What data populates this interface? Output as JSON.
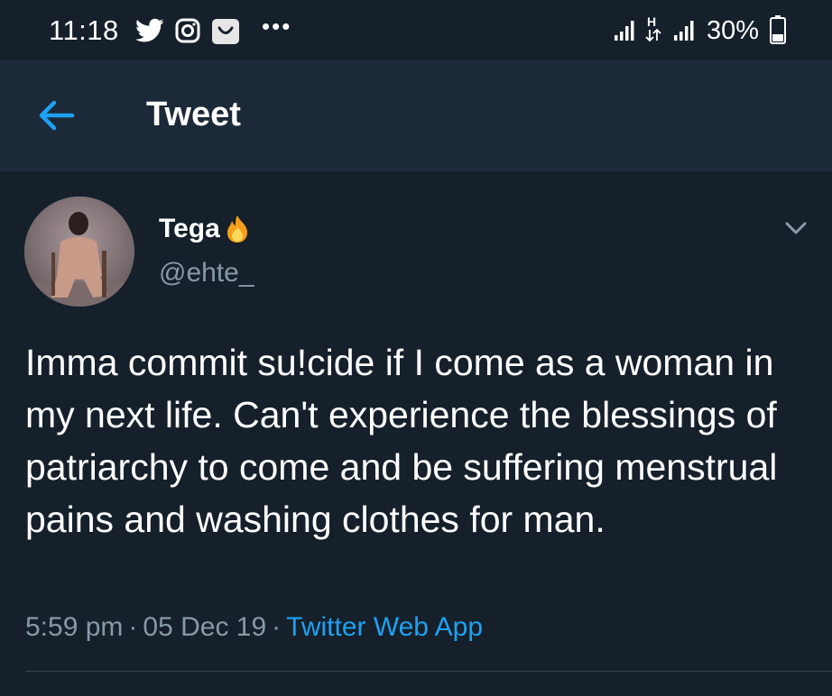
{
  "status_bar": {
    "time": "11:18",
    "battery": "30%",
    "overflow": "•••",
    "network_type": "H",
    "icons": [
      "twitter-icon",
      "instagram-icon",
      "shop-bag-icon",
      "signal-icon",
      "data-arrows-icon",
      "signal-icon",
      "battery-icon"
    ]
  },
  "header": {
    "title": "Tweet",
    "back_icon": "arrow-left-icon"
  },
  "tweet": {
    "display_name": "Tega",
    "name_emoji": "fire-icon",
    "handle": "@ehte_",
    "text": "Imma commit su!cide if I come as a woman in my next life. Can't experience the blessings of patriarchy to come and be suffering menstrual pains and washing clothes for man.",
    "time": "5:59 pm",
    "date": "05 Dec 19",
    "separator": "·",
    "source": "Twitter Web App",
    "menu_icon": "chevron-down-icon"
  },
  "colors": {
    "background": "#15202b",
    "header_background": "#1c2938",
    "accent": "#1da1f2",
    "secondary_text": "#8899a6",
    "divider": "#38444d"
  }
}
